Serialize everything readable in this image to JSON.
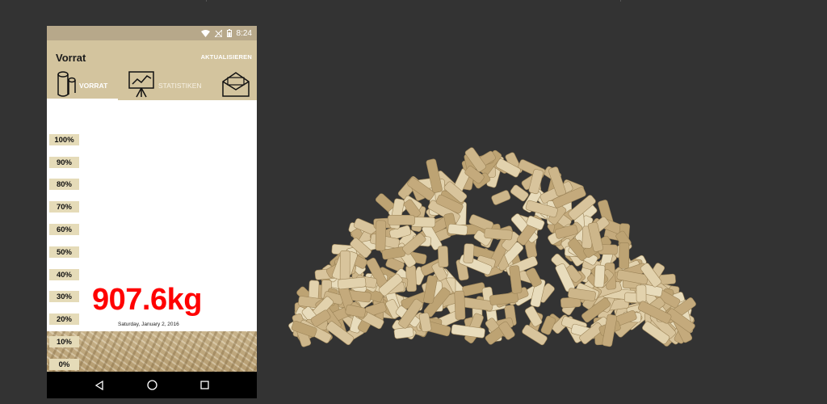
{
  "statusbar": {
    "time": "8:24"
  },
  "appbar": {
    "title": "Vorrat",
    "refresh_label": "AKTUALISIEREN"
  },
  "tabs": [
    {
      "label": "VORRAT",
      "icon": "log-icon",
      "selected": true
    },
    {
      "label": "STATISTIKEN",
      "icon": "chart-easel-icon",
      "selected": false
    },
    {
      "label": "",
      "icon": "mail-icon",
      "selected": false
    }
  ],
  "stock": {
    "scale": [
      "100%",
      "90%",
      "80%",
      "70%",
      "60%",
      "50%",
      "40%",
      "30%",
      "20%",
      "10%",
      "0%"
    ],
    "weight": "907.6kg",
    "date": "Saturday, January 2, 2016",
    "fill_percent": 15
  },
  "navbar": {
    "icons": [
      "back-icon",
      "home-icon",
      "recents-icon"
    ]
  },
  "colors": {
    "background": "#333333",
    "appbar": "#d3c49e",
    "statusbar": "#b7a88a",
    "scale_label": "#e5dbb8",
    "weight_text": "#ff0000",
    "pellet": "#c9b48c"
  }
}
